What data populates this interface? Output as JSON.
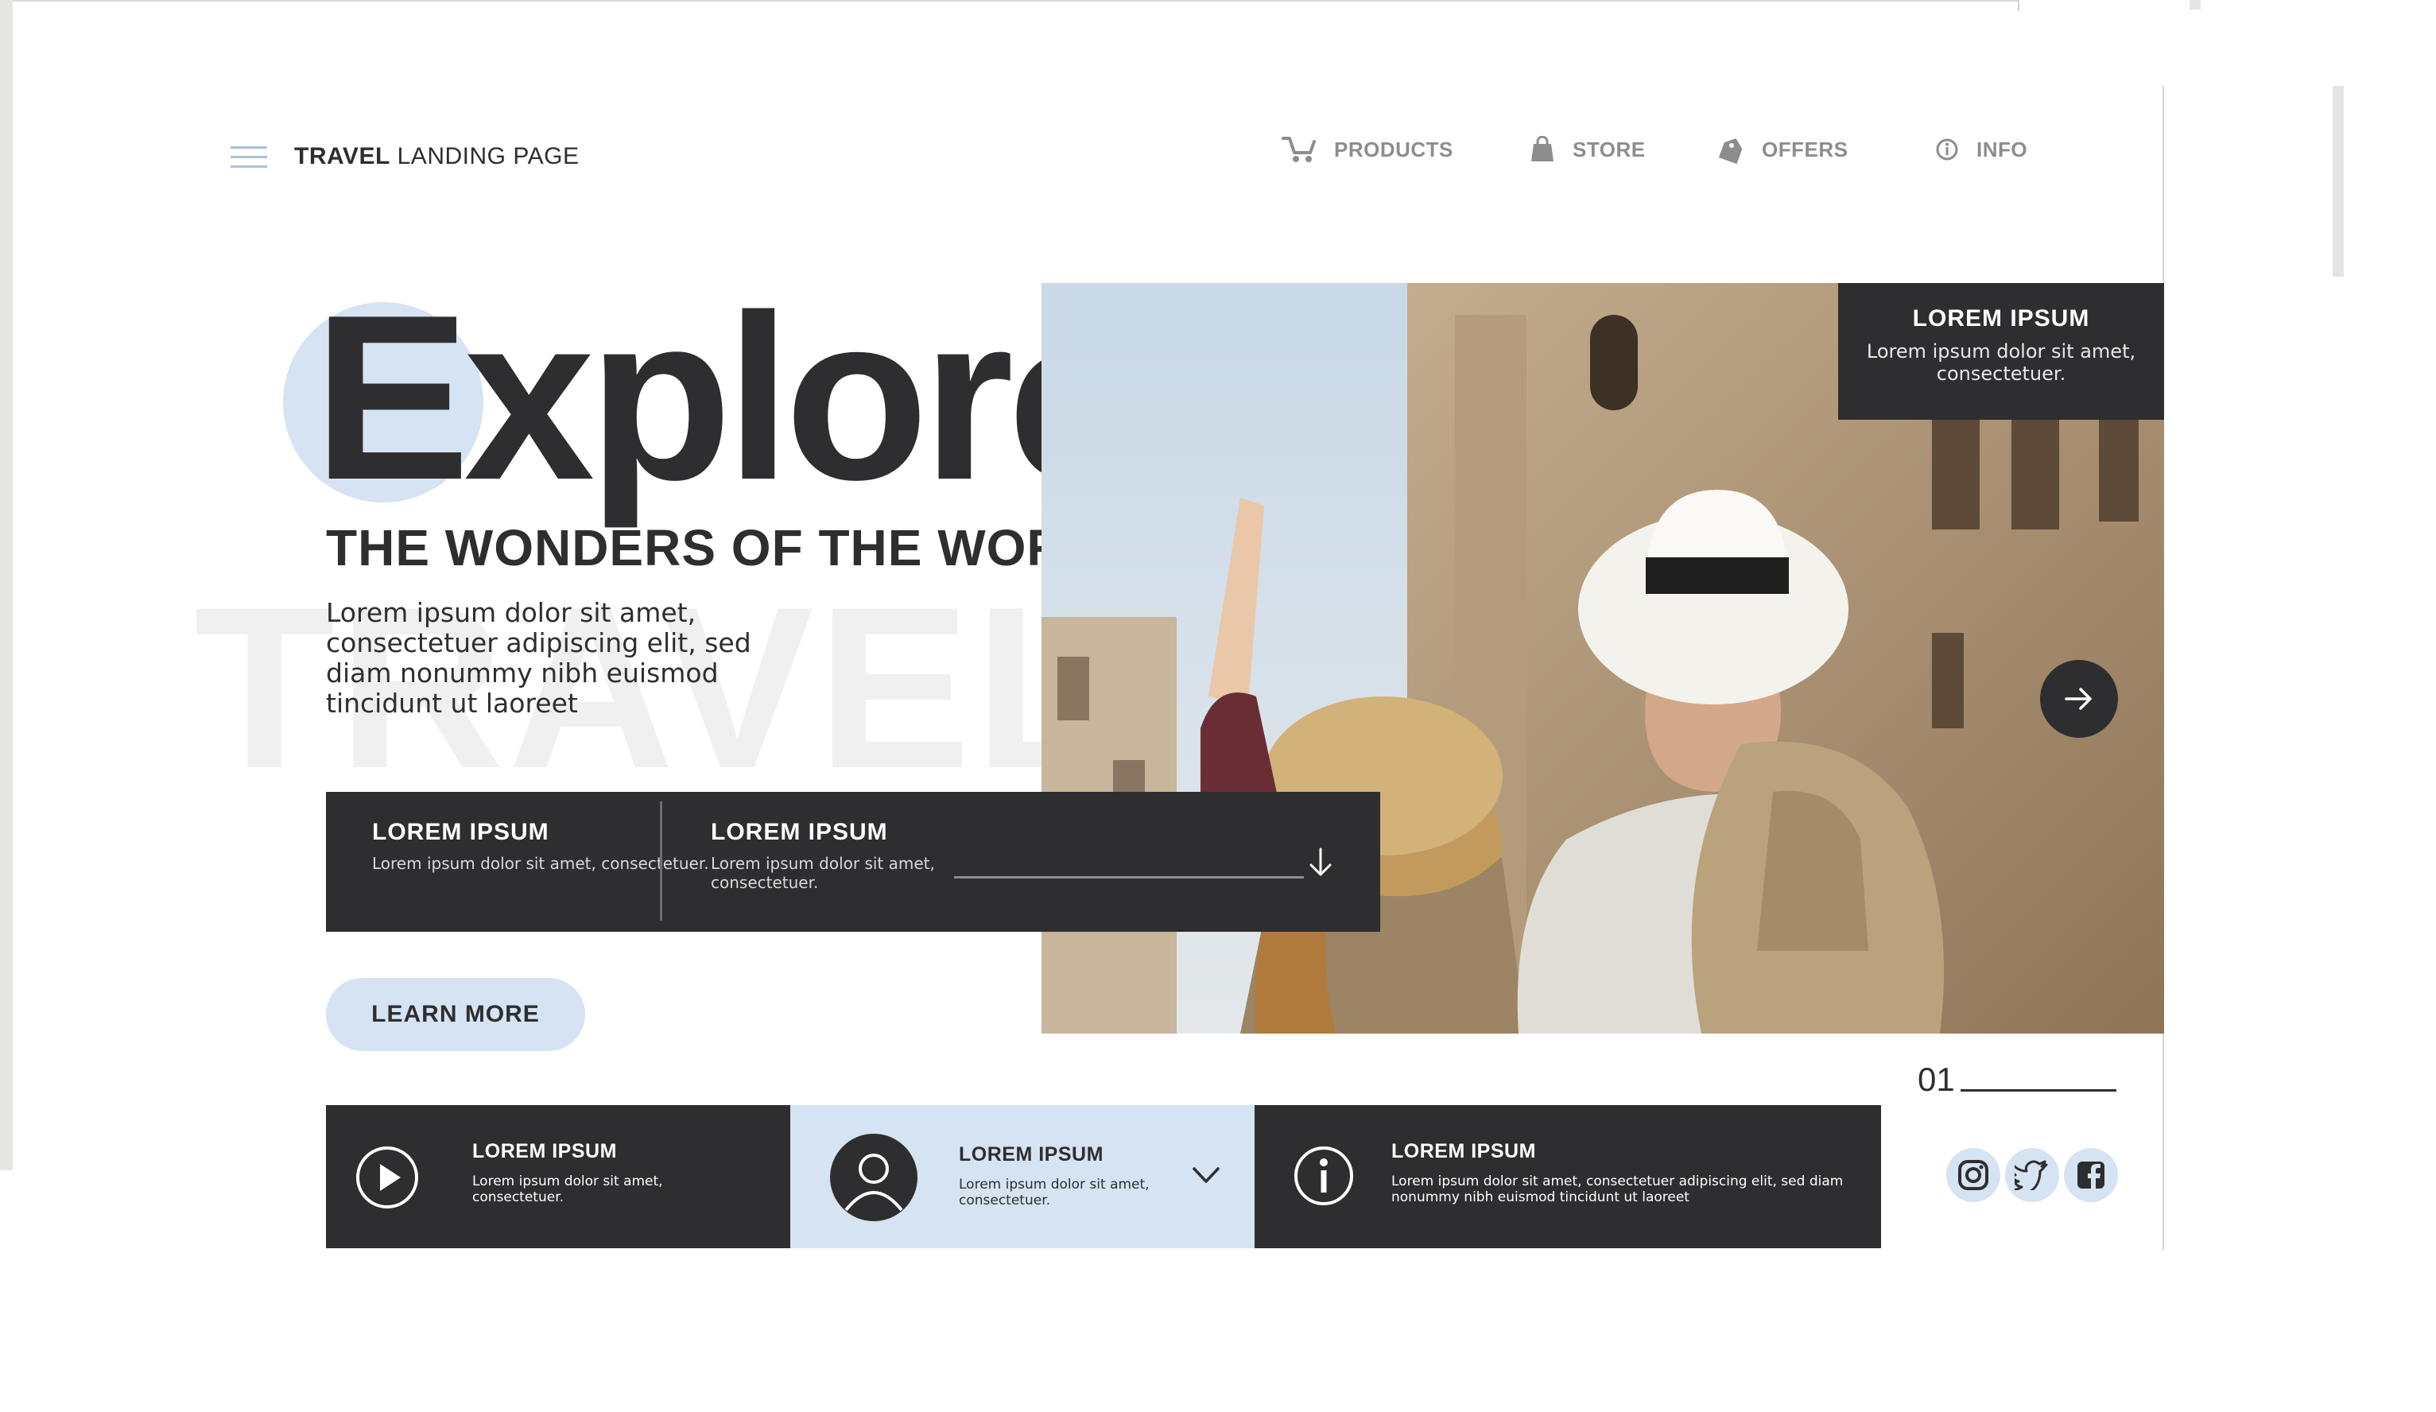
{
  "header": {
    "brand_bold": "TRAVEL",
    "brand_rest": "LANDING PAGE",
    "nav": [
      {
        "label": "PRODUCTS",
        "icon": "cart-icon"
      },
      {
        "label": "STORE",
        "icon": "shopping-bag-icon"
      },
      {
        "label": "OFFERS",
        "icon": "price-tag-icon"
      },
      {
        "label": "INFO",
        "icon": "info-icon"
      }
    ]
  },
  "hero": {
    "headline": "Explore",
    "subtitle": "THE WONDERS OF THE WORLD",
    "body": "Lorem ipsum dolor sit amet, consectetuer adipiscing elit, sed diam nonummy nibh euismod tincidunt ut laoreet",
    "watermark": "TRAVEL",
    "learn_more": "LEARN MORE",
    "page_number": "01"
  },
  "photo_card": {
    "title": "LOREM IPSUM",
    "text": "Lorem ipsum dolor sit amet, consectetuer."
  },
  "info_bar": [
    {
      "title": "LOREM IPSUM",
      "text": "Lorem ipsum dolor sit amet, consectetuer."
    },
    {
      "title": "LOREM IPSUM",
      "text": "Lorem ipsum dolor sit amet, consectetuer."
    }
  ],
  "cards": [
    {
      "title": "LOREM IPSUM",
      "text": "Lorem ipsum dolor sit amet, consectetuer.",
      "icon": "play-icon"
    },
    {
      "title": "LOREM IPSUM",
      "text": "Lorem ipsum dolor sit amet, consectetuer.",
      "icon": "user-icon"
    },
    {
      "title": "LOREM IPSUM",
      "text": "Lorem ipsum dolor sit amet, consectetuer adipiscing elit, sed diam nonummy nibh euismod tincidunt ut laoreet",
      "icon": "info-icon"
    }
  ],
  "social": [
    "instagram-icon",
    "twitter-icon",
    "facebook-icon"
  ],
  "colors": {
    "dark": "#2e2e30",
    "accent": "#d6e3f2",
    "nav_gray": "#8d8d8d"
  }
}
